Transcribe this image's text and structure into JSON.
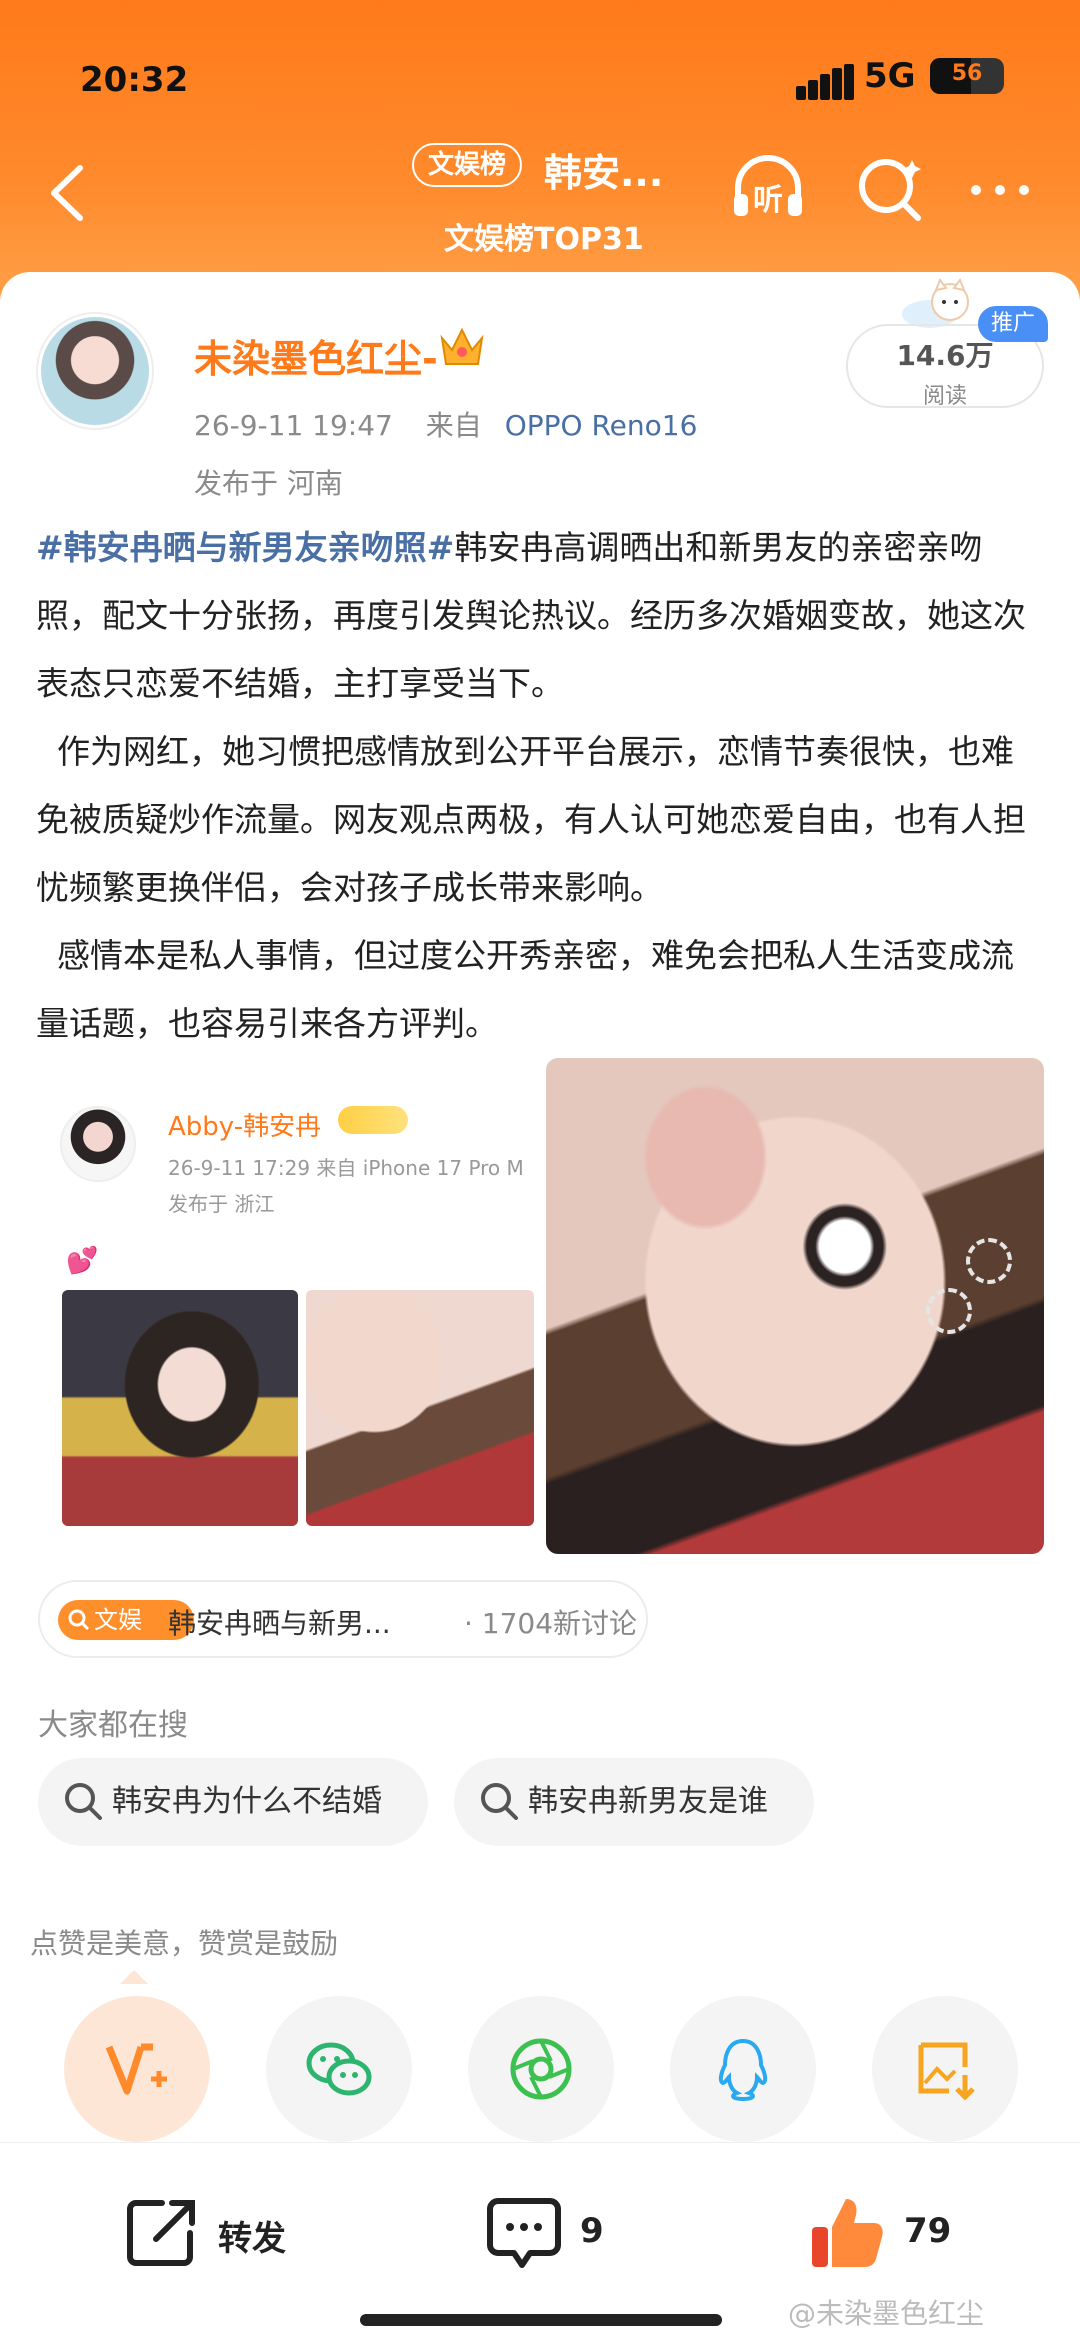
{
  "status": {
    "time": "20:32",
    "network": "5G",
    "battery": "56",
    "battery_fraction": 0.56
  },
  "header": {
    "badge": "文娱榜",
    "title": "韩安...",
    "subtitle": "文娱榜TOP31",
    "icons": [
      "back-icon",
      "listen-icon",
      "search-icon",
      "more-icon"
    ],
    "listen_label": "听"
  },
  "post": {
    "username": "未染墨色红尘-",
    "datetime": "26-9-11  19:47",
    "from_label": "来自",
    "device": "OPPO  Reno16",
    "location": "发布于  河南",
    "reads_value": "14.6万",
    "reads_label": "阅读",
    "promo": "推广",
    "hashtag": "#韩安冉晒与新男友亲吻照#",
    "p1_rest": "韩安冉高调晒出和新男友的亲密亲吻照，配文十分张扬，再度引发舆论热议。经历多次婚姻变故，她这次表态只恋爱不结婚，主打享受当下。",
    "p2": "作为网红，她习惯把感情放到公开平台展示，恋情节奏很快，也难免被质疑炒作流量。网友观点两极，有人认可她恋爱自由，也有人担忧频繁更换伴侣，会对孩子成长带来影响。",
    "p3": "感情本是私人事情，但过度公开秀亲密，难免会把私人生活变成流量话题，也容易引来各方评判。"
  },
  "embedded": {
    "name": "Abby-韩安冉",
    "meta": "26-9-11 17:29  来自 iPhone 17 Pro M",
    "location": "发布于 浙江",
    "heart": "💕"
  },
  "topic_chip": {
    "badge": "文娱",
    "text": "韩安冉晒与新男...",
    "count": "·  1704新讨论"
  },
  "search": {
    "title": "大家都在搜",
    "items": [
      "韩安冉为什么不结婚",
      "韩安冉新男友是谁"
    ]
  },
  "tip": "点赞是美意，赞赏是鼓励",
  "share_icons": [
    "reward-v-icon",
    "wechat-icon",
    "moments-icon",
    "qq-icon",
    "save-image-icon"
  ],
  "bottom": {
    "repost": "转发",
    "comments": "9",
    "likes": "79"
  },
  "watermark": "@未染墨色红尘",
  "colors": {
    "accent": "#ff7a1a",
    "link": "#4a6fa5",
    "promo": "#4a8ff5"
  }
}
